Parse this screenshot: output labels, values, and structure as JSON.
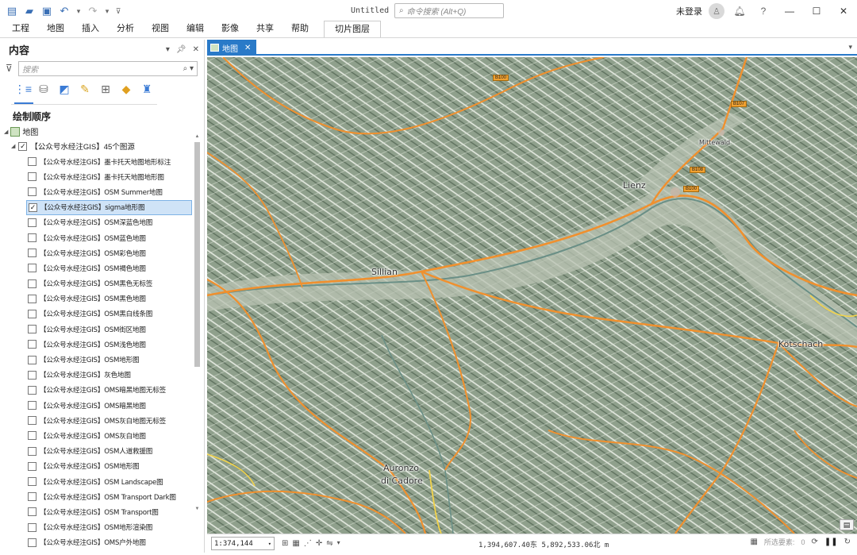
{
  "window": {
    "doc_title": "Untitled",
    "search_placeholder": "命令搜索 (Alt+Q)",
    "user_label": "未登录",
    "help_label": "?",
    "minimize": "—",
    "maximize": "☐",
    "close": "✕"
  },
  "menu": {
    "items": [
      "工程",
      "地图",
      "插入",
      "分析",
      "视图",
      "编辑",
      "影像",
      "共享",
      "帮助"
    ],
    "context_tab": "切片图层"
  },
  "contents": {
    "title": "内容",
    "search_placeholder": "搜索",
    "drawing_order_title": "绘制顺序",
    "root_label": "地图",
    "group_label": "【公众号水经注GIS】45个图源",
    "layers": [
      {
        "name": "【公众号水经注GIS】墨卡托天地图地形标注",
        "checked": false,
        "selected": false
      },
      {
        "name": "【公众号水经注GIS】墨卡托天地图地形图",
        "checked": false,
        "selected": false
      },
      {
        "name": "【公众号水经注GIS】OSM Summer地图",
        "checked": false,
        "selected": false
      },
      {
        "name": "【公众号水经注GIS】sigma地形图",
        "checked": true,
        "selected": true
      },
      {
        "name": "【公众号水经注GIS】OSM深蓝色地图",
        "checked": false,
        "selected": false
      },
      {
        "name": "【公众号水经注GIS】OSM蓝色地图",
        "checked": false,
        "selected": false
      },
      {
        "name": "【公众号水经注GIS】OSM彩色地图",
        "checked": false,
        "selected": false
      },
      {
        "name": "【公众号水经注GIS】OSM褐色地图",
        "checked": false,
        "selected": false
      },
      {
        "name": "【公众号水经注GIS】OSM黑色无标签",
        "checked": false,
        "selected": false
      },
      {
        "name": "【公众号水经注GIS】OSM黑色地图",
        "checked": false,
        "selected": false
      },
      {
        "name": "【公众号水经注GIS】OSM黑白线条图",
        "checked": false,
        "selected": false
      },
      {
        "name": "【公众号水经注GIS】OSM街区地图",
        "checked": false,
        "selected": false
      },
      {
        "name": "【公众号水经注GIS】OSM浅色地图",
        "checked": false,
        "selected": false
      },
      {
        "name": "【公众号水经注GIS】OSM地形图",
        "checked": false,
        "selected": false
      },
      {
        "name": "【公众号水经注GIS】灰色地图",
        "checked": false,
        "selected": false
      },
      {
        "name": "【公众号水经注GIS】OMS暗黑地图无标签",
        "checked": false,
        "selected": false
      },
      {
        "name": "【公众号水经注GIS】OMS暗黑地图",
        "checked": false,
        "selected": false
      },
      {
        "name": "【公众号水经注GIS】OMS灰白地图无标签",
        "checked": false,
        "selected": false
      },
      {
        "name": "【公众号水经注GIS】OMS灰白地图",
        "checked": false,
        "selected": false
      },
      {
        "name": "【公众号水经注GIS】OSM人道救援图",
        "checked": false,
        "selected": false
      },
      {
        "name": "【公众号水经注GIS】OSM地形图",
        "checked": false,
        "selected": false
      },
      {
        "name": "【公众号水经注GIS】OSM Landscape图",
        "checked": false,
        "selected": false
      },
      {
        "name": "【公众号水经注GIS】OSM Transport Dark图",
        "checked": false,
        "selected": false
      },
      {
        "name": "【公众号水经注GIS】OSM Transport图",
        "checked": false,
        "selected": false
      },
      {
        "name": "【公众号水经注GIS】OSM地形渲染图",
        "checked": false,
        "selected": false
      },
      {
        "name": "【公众号水经注GIS】OMS户外地图",
        "checked": false,
        "selected": false
      }
    ]
  },
  "map_tab": {
    "label": "地图"
  },
  "map": {
    "places": {
      "lienz": "Lienz",
      "sillian": "Sillian",
      "kotschach": "Kötschach",
      "auronzo1": "Auronzo",
      "auronzo2": "di Cadore",
      "small1": "Mittewald"
    },
    "colors": {
      "terrain": "#8fa08c",
      "road": "#f0902e",
      "river": "#6a8f86",
      "valley": "#b9c3b3"
    }
  },
  "status": {
    "scale": "1:374,144",
    "coordinates": "1,394,607.40东 5,892,533.06北 m",
    "selected_features_label": "所选要素:",
    "selected_count": "0"
  }
}
